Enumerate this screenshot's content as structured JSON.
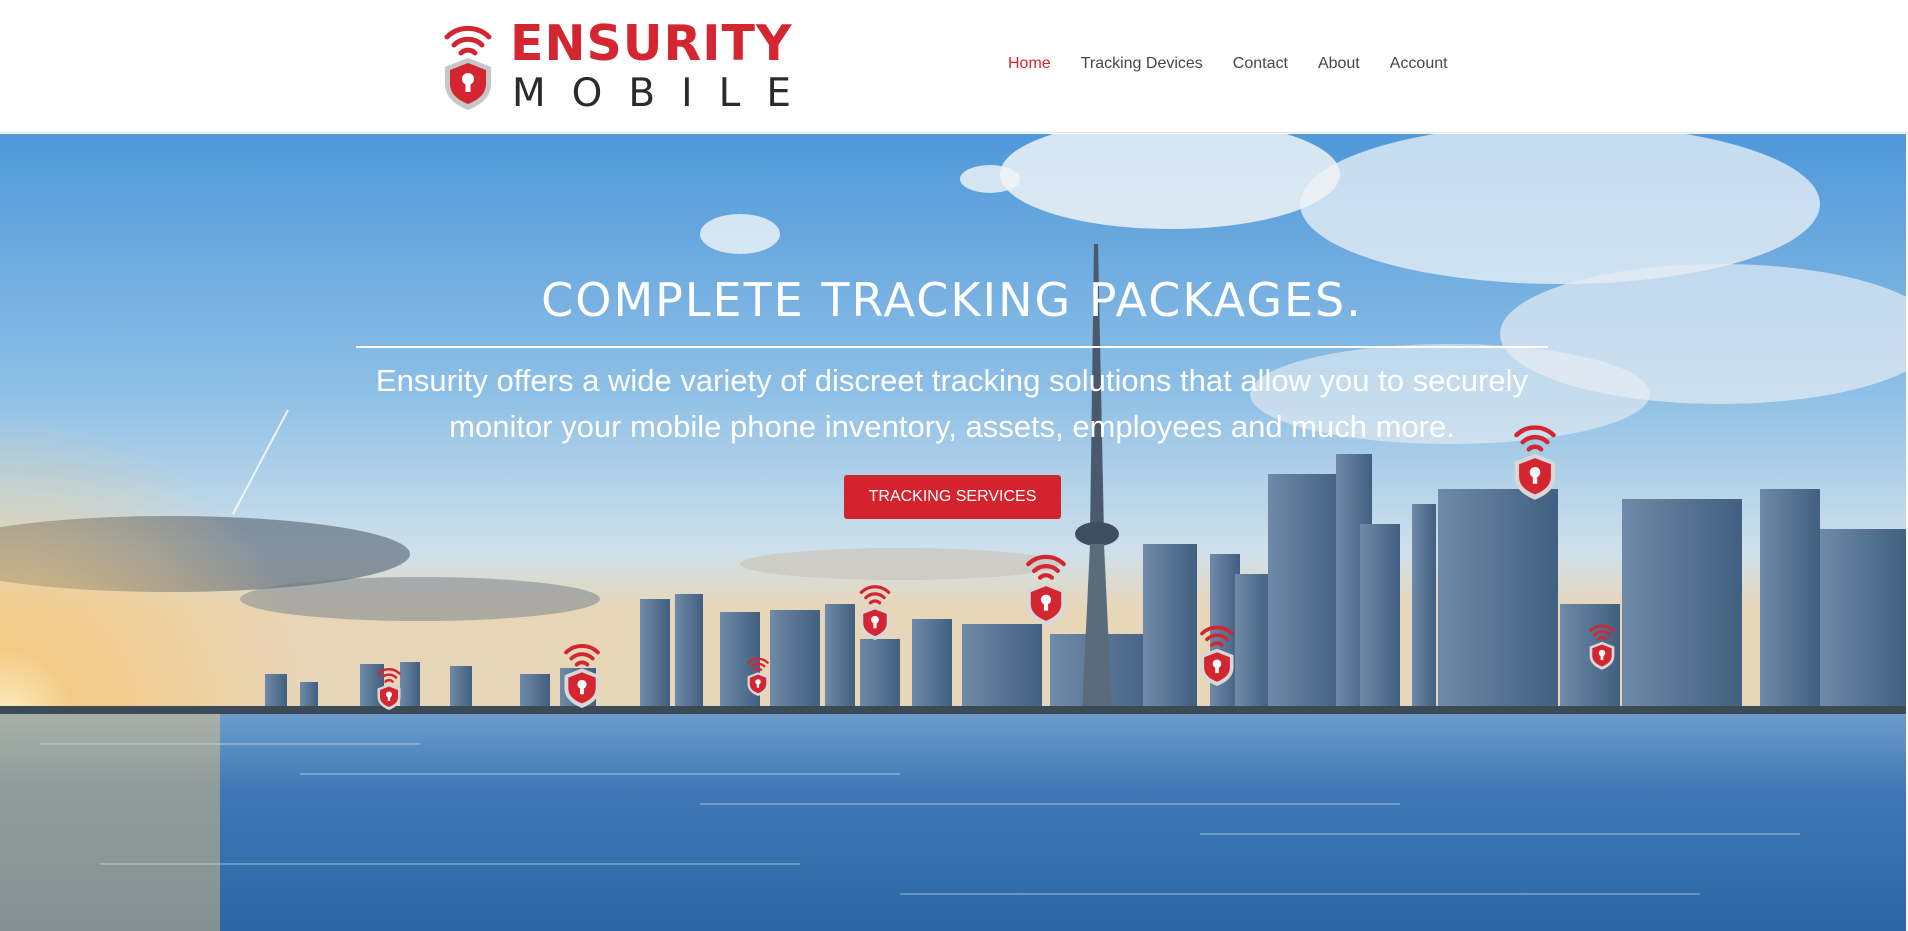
{
  "brand": {
    "name_line1": "ENSURITY",
    "name_line2": "MOBILE",
    "icon": "shield-lock-wifi-icon",
    "brand_color": "#d32630"
  },
  "nav": {
    "items": [
      {
        "label": "Home",
        "active": true
      },
      {
        "label": "Tracking Devices",
        "active": false
      },
      {
        "label": "Contact",
        "active": false
      },
      {
        "label": "About",
        "active": false
      },
      {
        "label": "Account",
        "active": false
      }
    ]
  },
  "hero": {
    "title": "COMPLETE TRACKING PACKAGES.",
    "text": "Ensurity offers a wide variety of discreet tracking solutions that allow you to securely monitor your mobile phone inventory, assets, employees and much more.",
    "button_label": "TRACKING SERVICES",
    "button_color": "#d3232c",
    "background": "city-skyline-waterfront-photo",
    "pin_icon": "shield-lock-wifi-icon"
  }
}
